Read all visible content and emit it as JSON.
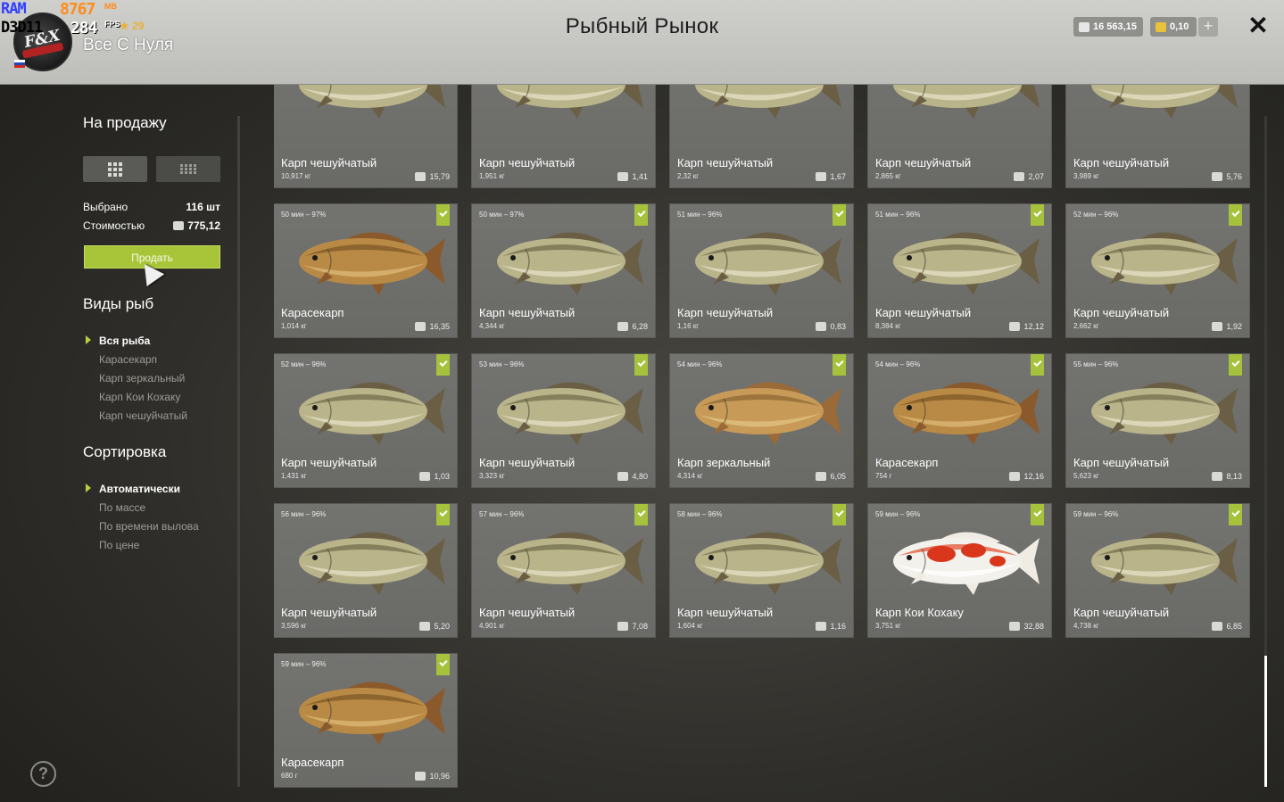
{
  "header": {
    "title": "Рыбный Рынок",
    "player_name": "Все С Нуля",
    "level": "29",
    "silver_balance": "16 563,15",
    "gold_balance": "0,10",
    "add_label": "+",
    "close_label": "✕"
  },
  "overlay": {
    "ram_label": "RAM",
    "ram_value": "8767",
    "ram_unit": "MB",
    "api_label": "D3D11",
    "fps_value": "284",
    "fps_label": "FPS"
  },
  "sidebar": {
    "for_sale_heading": "На продажу",
    "selected_label": "Выбрано",
    "selected_value": "116 шт",
    "cost_label": "Стоимостью",
    "cost_value": "775,12",
    "sell_button": "Продать",
    "species_heading": "Виды рыб",
    "species": [
      "Вся рыба",
      "Карасекарп",
      "Карп зеркальный",
      "Карп Кои Кохаку",
      "Карп чешуйчатый"
    ],
    "species_active": 0,
    "sort_heading": "Сортировка",
    "sort_options": [
      "Автоматически",
      "По массе",
      "По времени вылова",
      "По цене"
    ],
    "sort_active": 0,
    "help_label": "?"
  },
  "colors": {
    "accent": "#a8c53a",
    "header_bg": "#c8c8c5",
    "card_bg": "#6e6e6b"
  },
  "fish_cards": [
    {
      "time": "",
      "name": "Карп чешуйчатый",
      "weight": "10,917 кг",
      "price": "15,79",
      "kind": "common",
      "checked": false
    },
    {
      "time": "",
      "name": "Карп чешуйчатый",
      "weight": "1,951 кг",
      "price": "1,41",
      "kind": "common",
      "checked": false
    },
    {
      "time": "",
      "name": "Карп чешуйчатый",
      "weight": "2,32 кг",
      "price": "1,67",
      "kind": "common",
      "checked": false
    },
    {
      "time": "",
      "name": "Карп чешуйчатый",
      "weight": "2,865 кг",
      "price": "2,07",
      "kind": "common",
      "checked": false
    },
    {
      "time": "",
      "name": "Карп чешуйчатый",
      "weight": "3,989 кг",
      "price": "5,76",
      "kind": "common",
      "checked": false
    },
    {
      "time": "50 мин – 97%",
      "name": "Карасекарп",
      "weight": "1,014 кг",
      "price": "16,35",
      "kind": "crucian",
      "checked": true
    },
    {
      "time": "50 мин – 97%",
      "name": "Карп чешуйчатый",
      "weight": "4,344 кг",
      "price": "6,28",
      "kind": "common",
      "checked": true
    },
    {
      "time": "51 мин – 96%",
      "name": "Карп чешуйчатый",
      "weight": "1,16 кг",
      "price": "0,83",
      "kind": "common",
      "checked": true
    },
    {
      "time": "51 мин – 96%",
      "name": "Карп чешуйчатый",
      "weight": "8,384 кг",
      "price": "12,12",
      "kind": "common",
      "checked": true
    },
    {
      "time": "52 мин – 96%",
      "name": "Карп чешуйчатый",
      "weight": "2,662 кг",
      "price": "1,92",
      "kind": "common",
      "checked": true
    },
    {
      "time": "52 мин – 96%",
      "name": "Карп чешуйчатый",
      "weight": "1,431 кг",
      "price": "1,03",
      "kind": "common",
      "checked": true
    },
    {
      "time": "53 мин – 96%",
      "name": "Карп чешуйчатый",
      "weight": "3,323 кг",
      "price": "4,80",
      "kind": "common",
      "checked": true
    },
    {
      "time": "54 мин – 96%",
      "name": "Карп зеркальный",
      "weight": "4,314 кг",
      "price": "6,05",
      "kind": "mirror",
      "checked": true
    },
    {
      "time": "54 мин – 96%",
      "name": "Карасекарп",
      "weight": "754 г",
      "price": "12,16",
      "kind": "crucian",
      "checked": true
    },
    {
      "time": "55 мин – 96%",
      "name": "Карп чешуйчатый",
      "weight": "5,623 кг",
      "price": "8,13",
      "kind": "common",
      "checked": true
    },
    {
      "time": "56 мин – 96%",
      "name": "Карп чешуйчатый",
      "weight": "3,596 кг",
      "price": "5,20",
      "kind": "common",
      "checked": true
    },
    {
      "time": "57 мин – 96%",
      "name": "Карп чешуйчатый",
      "weight": "4,901 кг",
      "price": "7,08",
      "kind": "common",
      "checked": true
    },
    {
      "time": "58 мин – 96%",
      "name": "Карп чешуйчатый",
      "weight": "1,604 кг",
      "price": "1,16",
      "kind": "common",
      "checked": true
    },
    {
      "time": "59 мин – 96%",
      "name": "Карп Кои Кохаку",
      "weight": "3,751 кг",
      "price": "32,88",
      "kind": "koi",
      "checked": true
    },
    {
      "time": "59 мин – 96%",
      "name": "Карп чешуйчатый",
      "weight": "4,738 кг",
      "price": "6,85",
      "kind": "common",
      "checked": true
    },
    {
      "time": "59 мин – 96%",
      "name": "Карасекарп",
      "weight": "680 г",
      "price": "10,96",
      "kind": "crucian",
      "checked": true
    }
  ]
}
